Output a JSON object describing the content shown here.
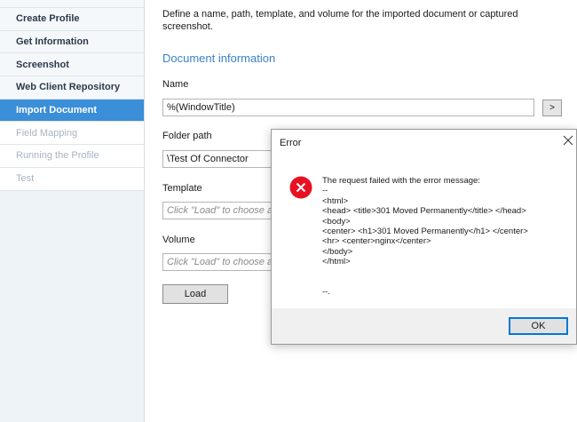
{
  "sidebar": {
    "items": [
      {
        "label": "Create Profile",
        "state": "normal"
      },
      {
        "label": "Get Information",
        "state": "normal"
      },
      {
        "label": "Screenshot",
        "state": "normal"
      },
      {
        "label": "Web Client Repository",
        "state": "normal"
      },
      {
        "label": "Import Document",
        "state": "active"
      },
      {
        "label": "Field Mapping",
        "state": "disabled"
      },
      {
        "label": "Running the Profile",
        "state": "disabled"
      },
      {
        "label": "Test",
        "state": "disabled"
      }
    ]
  },
  "main": {
    "intro": "Define a name, path, template, and volume for the imported document or captured screenshot.",
    "section_title": "Document information",
    "name_label": "Name",
    "name_value": "%(WindowTitle)",
    "browse_label": ">",
    "folder_label": "Folder path",
    "folder_value": "\\Test Of Connector",
    "template_label": "Template",
    "template_placeholder": "Click \"Load\" to choose a",
    "volume_label": "Volume",
    "volume_placeholder": "Click \"Load\" to choose a",
    "load_label": "Load"
  },
  "dialog": {
    "title": "Error",
    "message_lines": [
      "The request failed with the error message:",
      "--",
      "<html>",
      "<head> <title>301 Moved Permanently</title> </head>",
      "<body>",
      "<center> <h1>301 Moved Permanently</h1> </center>",
      "<hr> <center>nginx</center>",
      "</body>",
      "</html>",
      "",
      "--."
    ],
    "ok_label": "OK"
  },
  "colors": {
    "accent": "#3b8ed8",
    "section_title": "#3b82c4",
    "error_red": "#e81123"
  },
  "icons": {
    "dialog_close": "close-icon",
    "dialog_error": "error-icon"
  }
}
